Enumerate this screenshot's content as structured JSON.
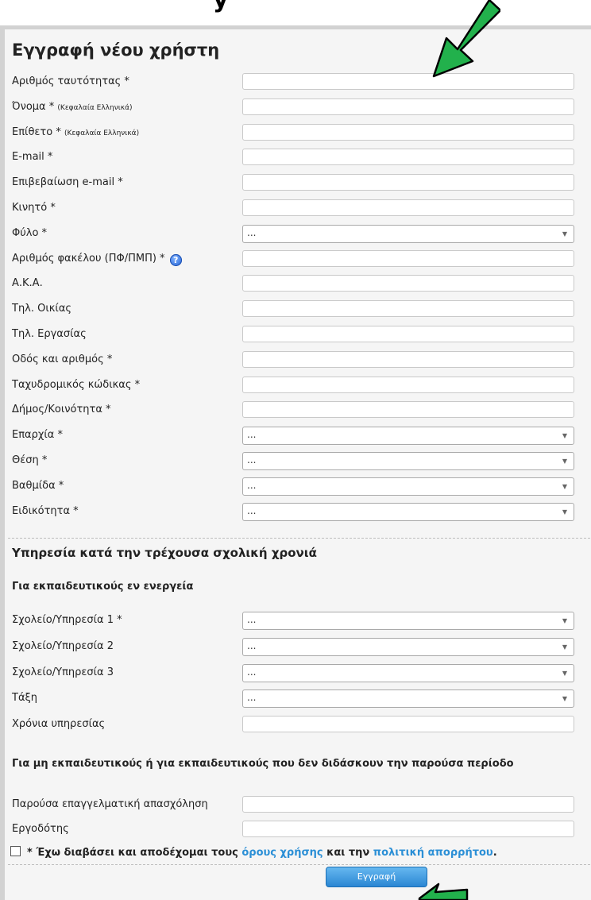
{
  "title": "Εγγραφή νέου χρήστη",
  "fields": [
    {
      "label": "Αριθμός ταυτότητας *",
      "type": "text"
    },
    {
      "label": "Όνομα *",
      "note": "(Κεφαλαία Ελληνικά)",
      "type": "text"
    },
    {
      "label": "Επίθετο *",
      "note": "(Κεφαλαία Ελληνικά)",
      "type": "text"
    },
    {
      "label": "E-mail *",
      "type": "text"
    },
    {
      "label": "Επιβεβαίωση e-mail *",
      "type": "text"
    },
    {
      "label": "Κινητό *",
      "type": "text"
    },
    {
      "label": "Φύλο *",
      "type": "select",
      "value": "..."
    },
    {
      "label": "Αριθμός φακέλου (ΠΦ/ΠΜΠ) *",
      "type": "text",
      "help": "help-icon"
    },
    {
      "label": "Α.Κ.Α.",
      "type": "text"
    },
    {
      "label": "Τηλ. Οικίας",
      "type": "text"
    },
    {
      "label": "Τηλ. Εργασίας",
      "type": "text"
    },
    {
      "label": "Οδός και αριθμός *",
      "type": "text"
    },
    {
      "label": "Ταχυδρομικός κώδικας *",
      "type": "text"
    },
    {
      "label": "Δήμος/Κοινότητα *",
      "type": "text"
    },
    {
      "label": "Επαρχία *",
      "type": "select",
      "value": "..."
    },
    {
      "label": "Θέση *",
      "type": "select",
      "value": "..."
    },
    {
      "label": "Βαθμίδα *",
      "type": "select",
      "value": "..."
    },
    {
      "label": "Ειδικότητα *",
      "type": "select",
      "value": "..."
    }
  ],
  "service_section": {
    "title": "Υπηρεσία κατά την τρέχουσα σχολική χρονιά",
    "active_title": "Για εκπαιδευτικούς εν ενεργεία",
    "active_fields": [
      {
        "label": "Σχολείο/Υπηρεσία 1 *",
        "type": "select",
        "value": "..."
      },
      {
        "label": "Σχολείο/Υπηρεσία 2",
        "type": "select",
        "value": "..."
      },
      {
        "label": "Σχολείο/Υπηρεσία 3",
        "type": "select",
        "value": "..."
      },
      {
        "label": "Τάξη",
        "type": "select",
        "value": "..."
      },
      {
        "label": "Χρόνια υπηρεσίας",
        "type": "text"
      }
    ],
    "other_title": "Για μη εκπαιδευτικούς ή για εκπαιδευτικούς που δεν διδάσκουν την παρούσα περίοδο",
    "other_fields": [
      {
        "label": "Παρούσα επαγγελματική απασχόληση",
        "type": "text"
      },
      {
        "label": "Εργοδότης",
        "type": "text"
      }
    ]
  },
  "terms": {
    "prefix": "* Έχω διαβάσει και αποδέχομαι τους ",
    "terms_link": "όρους χρήσης",
    "middle": " και την ",
    "privacy_link": "πολιτική απορρήτου",
    "suffix": "."
  },
  "submit_label": "Εγγραφή",
  "colors": {
    "arrow_fill": "#22b14c",
    "link": "#2b8fd6",
    "button": "#2a86d3"
  },
  "icons": [
    "help-icon",
    "checkbox",
    "chevron-down-icon",
    "arrow-icon"
  ]
}
